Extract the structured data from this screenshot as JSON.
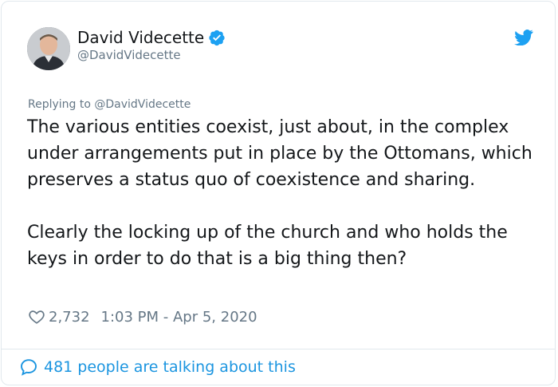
{
  "author": {
    "name": "David Videcette",
    "handle": "@DavidVidecette",
    "verified": true
  },
  "reply": {
    "prefix": "Replying to",
    "target": "@DavidVidecette"
  },
  "tweet": {
    "paragraph1": "The various entities coexist, just about,  in the complex under arrangements put in place by the Ottomans, which preserves a status quo of coexistence and sharing.",
    "paragraph2": "Clearly the locking up of the church and who holds the keys in order to do that is a big thing then?"
  },
  "stats": {
    "likes": "2,732",
    "timestamp": "1:03 PM - Apr 5, 2020"
  },
  "footer": {
    "talking": "481 people are talking about this"
  },
  "icons": {
    "brand": "twitter-bird-icon",
    "verified": "verified-badge-icon",
    "like": "heart-icon",
    "reply": "speech-bubble-icon"
  },
  "colors": {
    "accent": "#1da1f2",
    "link": "#1b95e0",
    "muted": "#657786",
    "text": "#14171a",
    "border": "#e1e8ed"
  }
}
